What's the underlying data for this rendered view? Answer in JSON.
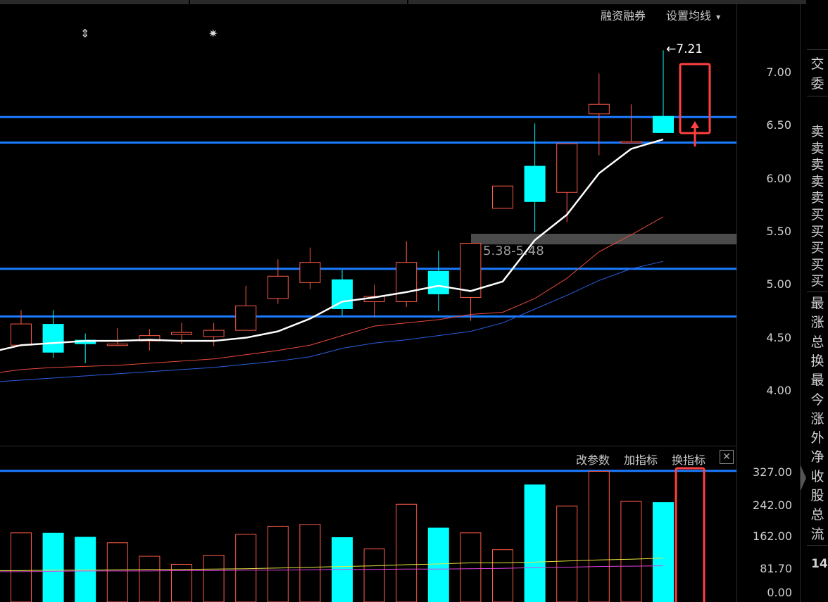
{
  "toolbar": {
    "margin_label": "融资融券",
    "ma_label": "设置均线",
    "ma_caret": "▾",
    "modify_params": "改参数",
    "add_indicator": "加指标",
    "switch_indicator": "换指标",
    "close_glyph": "✕"
  },
  "price_axis": [
    "7.00",
    "6.50",
    "6.00",
    "5.50",
    "5.00",
    "4.50",
    "4.00"
  ],
  "volume_axis": [
    "327.00",
    "242.00",
    "162.00",
    "81.70",
    "0.00"
  ],
  "annotations": {
    "high_marker": "7.21",
    "range_band": "5.38-5.48",
    "event_mark_1": "⇕",
    "event_mark_2": "✷"
  },
  "side_panel": {
    "items_top": [
      "交",
      "委"
    ],
    "items_order": [
      "卖",
      "卖",
      "卖",
      "卖",
      "卖",
      "买",
      "买",
      "买",
      "买",
      "买"
    ],
    "items_info": [
      "最",
      "涨",
      "总",
      "换",
      "最",
      "今",
      "涨",
      "外",
      "净",
      "收",
      "股",
      "总",
      "流"
    ],
    "bottom_value": "14"
  },
  "colors": {
    "up": "#ff5a4a",
    "down": "#00ffff",
    "ma5": "#ffffff",
    "ma10": "#e84a3c",
    "ma20": "#2a5fe0",
    "level_line": "#1a7bff",
    "highlight_box": "#ff4040"
  },
  "chart_data": {
    "type": "candlestick",
    "price_ylim": [
      3.5,
      7.45
    ],
    "candles": [
      {
        "open": 4.43,
        "close": 4.63,
        "high": 4.76,
        "low": 4.42
      },
      {
        "open": 4.63,
        "close": 4.36,
        "high": 4.76,
        "low": 4.31
      },
      {
        "open": 4.48,
        "close": 4.44,
        "high": 4.54,
        "low": 4.26
      },
      {
        "open": 4.43,
        "close": 4.44,
        "high": 4.59,
        "low": 4.42
      },
      {
        "open": 4.47,
        "close": 4.52,
        "high": 4.58,
        "low": 4.38
      },
      {
        "open": 4.53,
        "close": 4.55,
        "high": 4.64,
        "low": 4.44
      },
      {
        "open": 4.51,
        "close": 4.57,
        "high": 4.64,
        "low": 4.42
      },
      {
        "open": 4.57,
        "close": 4.8,
        "high": 4.99,
        "low": 4.57
      },
      {
        "open": 4.87,
        "close": 5.08,
        "high": 5.24,
        "low": 4.82
      },
      {
        "open": 5.02,
        "close": 5.21,
        "high": 5.35,
        "low": 4.96
      },
      {
        "open": 5.05,
        "close": 4.77,
        "high": 5.14,
        "low": 4.71
      },
      {
        "open": 4.84,
        "close": 4.89,
        "high": 5.0,
        "low": 4.7
      },
      {
        "open": 4.84,
        "close": 5.21,
        "high": 5.41,
        "low": 4.79
      },
      {
        "open": 5.13,
        "close": 4.91,
        "high": 5.32,
        "low": 4.75
      },
      {
        "open": 4.88,
        "close": 5.39,
        "high": 5.39,
        "low": 4.66
      },
      {
        "open": 5.72,
        "close": 5.93,
        "high": 5.93,
        "low": 5.72
      },
      {
        "open": 6.12,
        "close": 5.78,
        "high": 6.52,
        "low": 5.5
      },
      {
        "open": 5.87,
        "close": 6.33,
        "high": 6.33,
        "low": 5.59
      },
      {
        "open": 6.61,
        "close": 6.7,
        "high": 6.99,
        "low": 6.22
      },
      {
        "open": 6.35,
        "close": 6.35,
        "high": 6.7,
        "low": 6.35
      },
      {
        "open": 6.59,
        "close": 6.43,
        "high": 7.21,
        "low": 6.43
      }
    ],
    "ma5": [
      4.36,
      4.43,
      4.45,
      4.47,
      4.47,
      4.48,
      4.47,
      4.47,
      4.5,
      4.56,
      4.68,
      4.84,
      4.88,
      4.93,
      4.99,
      4.94,
      5.03,
      5.42,
      5.66,
      6.05,
      6.28,
      6.37
    ],
    "ma10": [
      4.16,
      4.2,
      4.22,
      4.23,
      4.24,
      4.26,
      4.28,
      4.3,
      4.34,
      4.38,
      4.43,
      4.52,
      4.61,
      4.64,
      4.67,
      4.72,
      4.74,
      4.87,
      5.06,
      5.31,
      5.47,
      5.64
    ],
    "ma20": [
      4.08,
      4.1,
      4.12,
      4.14,
      4.16,
      4.18,
      4.2,
      4.22,
      4.25,
      4.28,
      4.32,
      4.4,
      4.45,
      4.48,
      4.52,
      4.56,
      4.64,
      4.77,
      4.9,
      5.04,
      5.15,
      5.22
    ],
    "level_lines": [
      6.58,
      6.34,
      5.15,
      4.7
    ],
    "range_band": [
      5.38,
      5.48
    ],
    "volume_ylim": [
      0,
      330
    ],
    "volume": [
      162,
      162,
      151,
      135,
      98,
      76,
      101,
      158,
      180,
      185,
      150,
      118,
      240,
      176,
      162,
      116,
      294,
      235,
      330,
      248,
      246
    ],
    "volume_ma_a": [
      59,
      60,
      60,
      61,
      62,
      62,
      63,
      64,
      66,
      68,
      70,
      72,
      75,
      77,
      80,
      80,
      82,
      85,
      88,
      90,
      93
    ],
    "volume_ma_b": [
      56,
      57,
      58,
      58,
      58,
      59,
      59,
      60,
      60,
      61,
      62,
      62,
      63,
      63,
      64,
      65,
      67,
      68,
      70,
      71,
      72
    ],
    "volume_level_line": 312
  }
}
